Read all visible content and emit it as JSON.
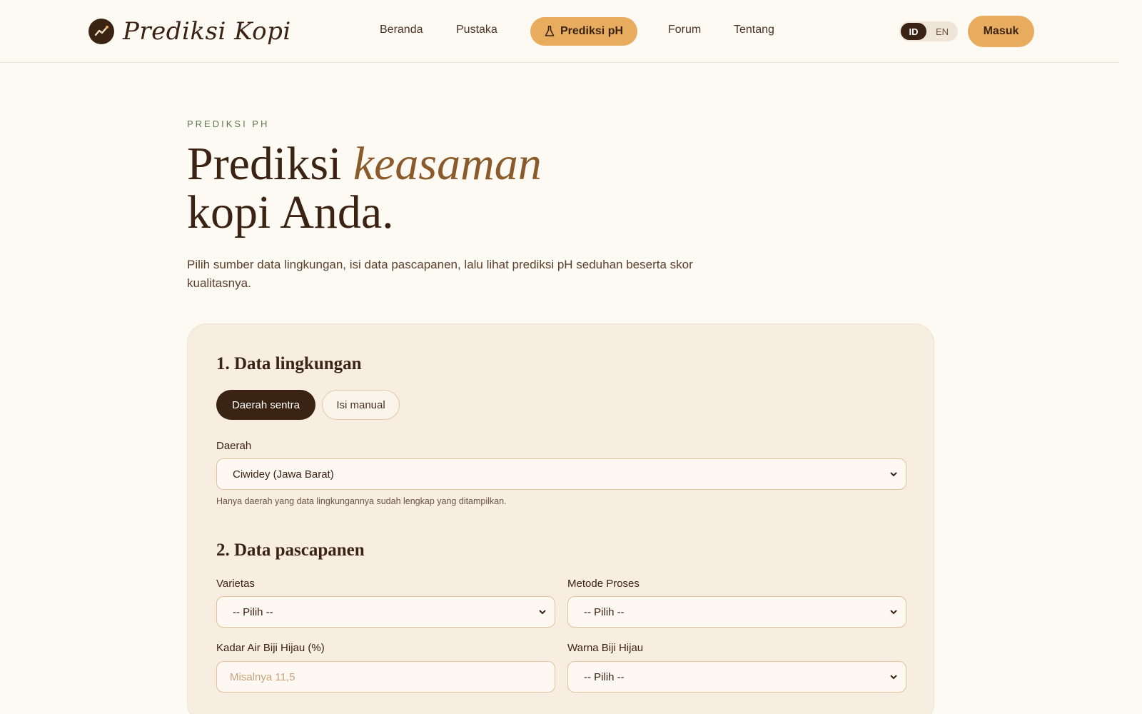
{
  "brand": {
    "name": "Prediksi Kopi",
    "icon": "trend-up-icon"
  },
  "nav": {
    "items": [
      {
        "label": "Beranda"
      },
      {
        "label": "Pustaka"
      },
      {
        "label": "Prediksi pH",
        "active": true,
        "icon": "flask-icon"
      },
      {
        "label": "Forum"
      },
      {
        "label": "Tentang"
      }
    ],
    "lang": {
      "options": [
        "ID",
        "EN"
      ],
      "selected": "ID"
    },
    "login_label": "Masuk"
  },
  "hero": {
    "eyebrow": "PREDIKSI PH",
    "title_part1": "Prediksi ",
    "title_accent": "keasaman",
    "title_part2": "kopi Anda.",
    "subtitle": "Pilih sumber data lingkungan, isi data pascapanen, lalu lihat prediksi pH seduhan beserta skor kualitasnya."
  },
  "form": {
    "section1": {
      "title": "1. Data lingkungan",
      "source_options": [
        "Daerah sentra",
        "Isi manual"
      ],
      "selected_source": "Daerah sentra",
      "region_label": "Daerah",
      "region_value": "Ciwidey (Jawa Barat)",
      "region_hint": "Hanya daerah yang data lingkungannya sudah lengkap yang ditampilkan."
    },
    "section2": {
      "title": "2. Data pascapanen",
      "varietas_label": "Varietas",
      "varietas_value": "-- Pilih --",
      "metode_label": "Metode Proses",
      "metode_value": "-- Pilih --",
      "kadar_label": "Kadar Air Biji Hijau (%)",
      "kadar_placeholder": "Misalnya 11,5",
      "warna_label": "Warna Biji Hijau",
      "warna_value": "-- Pilih --"
    }
  },
  "colors": {
    "accent": "#e8ac5f",
    "dark": "#3b2314",
    "background": "#fdf9f3",
    "card": "#f7ede0",
    "eyebrow": "#5d7a4f"
  }
}
